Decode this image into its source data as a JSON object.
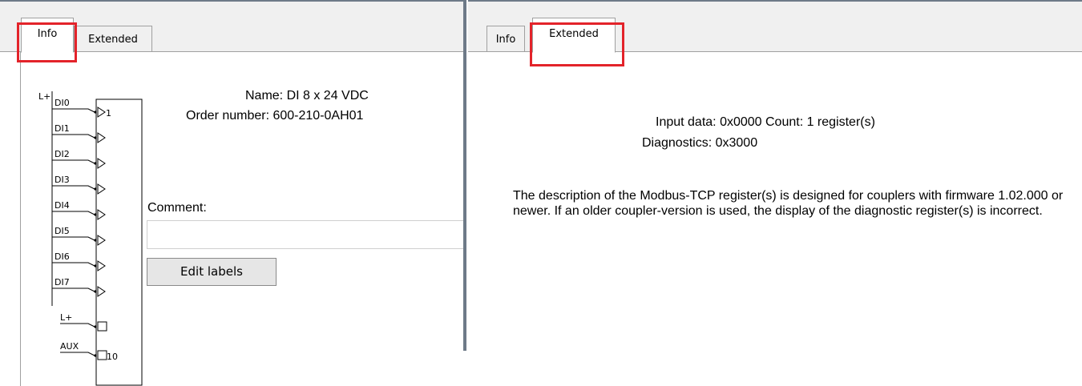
{
  "left": {
    "tabs": [
      {
        "label": "Info"
      },
      {
        "label": "Extended"
      }
    ],
    "active_tab": "Info",
    "name_label": "Name: DI 8 x 24 VDC",
    "order_label": "Order number: 600-210-0AH01",
    "comment_label": "Comment:",
    "comment_value": "",
    "edit_labels_button": "Edit labels",
    "diagram": {
      "supply_label": "L+",
      "inputs": [
        "DI0",
        "DI1",
        "DI2",
        "DI3",
        "DI4",
        "DI5",
        "DI6",
        "DI7"
      ],
      "first_output_number": "1",
      "bottom_pins": [
        {
          "label": "L+",
          "number": ""
        },
        {
          "label": "AUX",
          "number": "10"
        }
      ]
    }
  },
  "right": {
    "tabs": [
      {
        "label": "Info"
      },
      {
        "label": "Extended"
      }
    ],
    "active_tab": "Extended",
    "input_data": "Input data: 0x0000 Count: 1 register(s)",
    "diagnostics": "Diagnostics: 0x3000",
    "description": "The description of the Modbus-TCP register(s) is designed for couplers with firmware 1.02.000 or newer. If an older coupler-version is used, the display of the diagnostic register(s) is incorrect."
  },
  "colors": {
    "highlight": "#e3232a",
    "splitter": "#6e7a88"
  }
}
